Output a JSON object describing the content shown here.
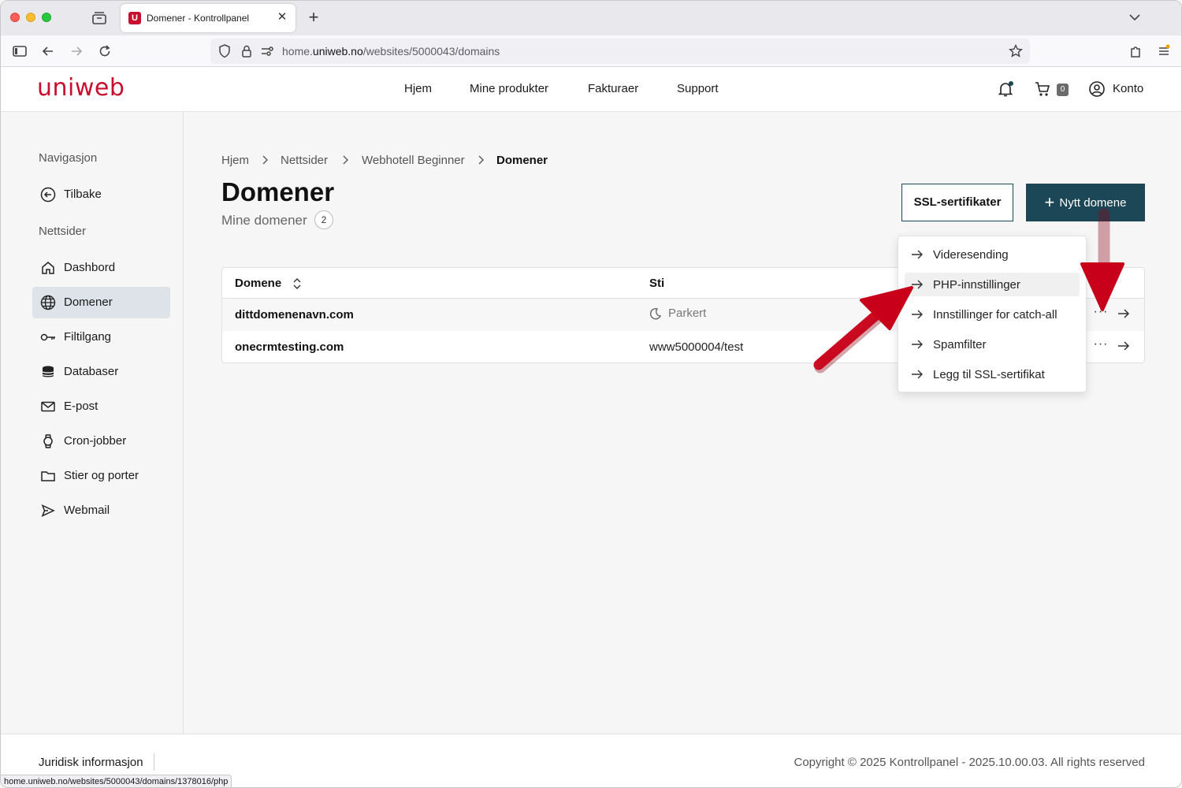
{
  "browser": {
    "tab_title": "Domener - Kontrollpanel",
    "favicon_letter": "U",
    "url_prefix": "home.",
    "url_host": "uniweb.no",
    "url_path": "/websites/5000043/domains",
    "status_url": "home.uniweb.no/websites/5000043/domains/1378016/php"
  },
  "header": {
    "logo": "uniweb",
    "nav": [
      "Hjem",
      "Mine produkter",
      "Fakturaer",
      "Support"
    ],
    "cart_count": "0",
    "account_label": "Konto"
  },
  "sidebar": {
    "nav_heading": "Navigasjon",
    "back_label": "Tilbake",
    "section_heading": "Nettsider",
    "items": [
      {
        "label": "Dashbord",
        "icon": "home-icon"
      },
      {
        "label": "Domener",
        "icon": "globe-icon",
        "active": true
      },
      {
        "label": "Filtilgang",
        "icon": "key-icon"
      },
      {
        "label": "Databaser",
        "icon": "database-icon"
      },
      {
        "label": "E-post",
        "icon": "mail-icon"
      },
      {
        "label": "Cron-jobber",
        "icon": "watch-icon"
      },
      {
        "label": "Stier og porter",
        "icon": "folder-icon"
      },
      {
        "label": "Webmail",
        "icon": "send-icon"
      }
    ]
  },
  "breadcrumb": [
    "Hjem",
    "Nettsider",
    "Webhotell Beginner",
    "Domener"
  ],
  "page": {
    "title": "Domener",
    "subtitle": "Mine domener",
    "count": "2",
    "ssl_button": "SSL-sertifikater",
    "new_button": "Nytt domene"
  },
  "table": {
    "col_domain": "Domene",
    "col_path": "Sti",
    "rows": [
      {
        "domain": "dittdomenenavn.com",
        "path": "Parkert",
        "parked": true
      },
      {
        "domain": "onecrmtesting.com",
        "path": "www5000004/test",
        "parked": false
      }
    ],
    "more_symbol": "···"
  },
  "dropdown": {
    "items": [
      "Videresending",
      "PHP-innstillinger",
      "Innstillinger for catch-all",
      "Spamfilter",
      "Legg til SSL-sertifikat"
    ],
    "hover_index": 1
  },
  "footer": {
    "legal": "Juridisk informasjon",
    "copyright": "Copyright © 2025 Kontrollpanel - 2025.10.00.03. All rights reserved"
  },
  "colors": {
    "brand_red": "#c8102e",
    "primary_teal": "#1c4757",
    "annotation_red": "#d0021b"
  }
}
